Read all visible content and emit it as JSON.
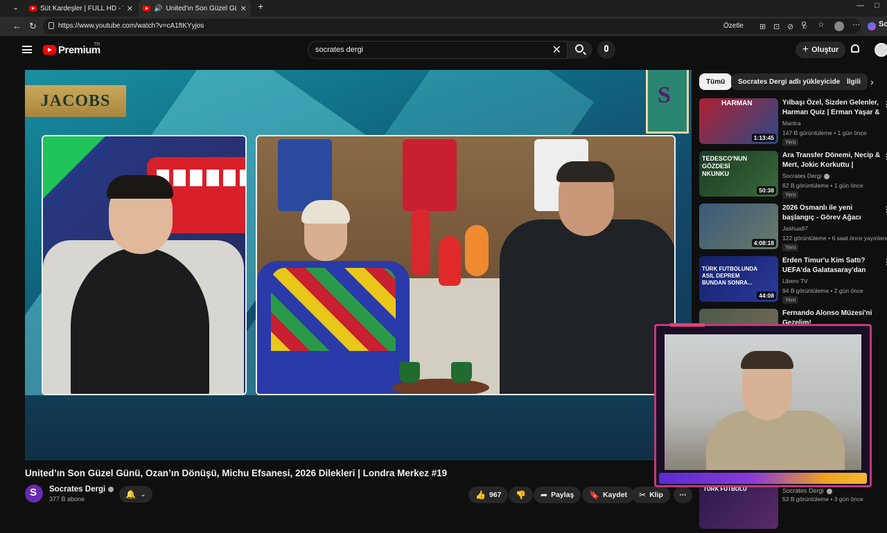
{
  "browser": {
    "tabs": [
      {
        "title": "Süt Kardeşler | FULL HD - YouTube",
        "close": "✕"
      },
      {
        "title": "United'ın Son Güzel Günü, Oza",
        "close": "✕"
      }
    ],
    "new_tab": "+",
    "url": "https://www.youtube.com/watch?v=cA1ftKYyjos",
    "summarize_label": "Özetle",
    "profile_label": "Sc",
    "window_controls": [
      "—",
      "□"
    ]
  },
  "youtube": {
    "brand": "Premium",
    "brand_region": "TR",
    "search": {
      "value": "socrates dergi",
      "clear": "✕"
    },
    "create_label": "Oluştur"
  },
  "video": {
    "sponsor": "JACOBS",
    "crest_letter": "S",
    "title": "United’ın Son Güzel Günü, Ozan’ın Dönüşü, Michu Efsanesi, 2026 Dilekleri | Londra Merkez #19",
    "channel": "Socrates Dergi",
    "channel_initial": "S",
    "subscribers": "377 B abone",
    "likes": "967",
    "actions": {
      "share": "Paylaş",
      "save": "Kaydet",
      "clip": "Klip",
      "more": "⋯"
    }
  },
  "chips": [
    {
      "label": "Tümü",
      "selected": true
    },
    {
      "label": "Socrates Dergi adlı yükleyiciden",
      "selected": false
    },
    {
      "label": "İlgili",
      "selected": false
    }
  ],
  "recommendations": [
    {
      "title": "Yılbaşı Özel, Sizden Gelenler, Harman Quiz | Erman Yaşar & ...",
      "channel": "Mantra",
      "meta": "147 B görüntüleme • 1 gün önce",
      "badge": "Yeni",
      "duration": "1:13:45",
      "thumb_text": "HARMAN",
      "thumb_color": "#b02030"
    },
    {
      "title": "Ara Transfer Dönemi, Necip & Mert, Jokic Korkuttu | Mehmet...",
      "channel": "Socrates Dergi",
      "meta": "62 B görüntüleme • 1 gün önce",
      "badge": "Yeni",
      "duration": "50:38",
      "thumb_text": "TEDESCO'NUN GÖZDESİ NKUNKU",
      "thumb_color": "#2a6a3a"
    },
    {
      "title": "2026 Osmanlı ile yeni başlangıç - Görev Ağacı tamamlamaca",
      "channel": "Jashua97",
      "meta": "122 görüntüleme • 6 saat önce yayınlandı",
      "badge": "Yeni",
      "duration": "4:08:18",
      "thumb_text": "",
      "thumb_color": "#4a6a8a"
    },
    {
      "title": "Erden Timur'u Kim Sattı? UEFA'da Galatasaray'dan Daha...",
      "channel": "Libero TV",
      "meta": "94 B görüntüleme • 2 gün önce",
      "badge": "Yeni",
      "duration": "44:08",
      "thumb_text": "TÜRK FUTBOLUNDA ASIL DEPREM BUNDAN SONRA...",
      "thumb_color": "#1a2a6a"
    },
    {
      "title": "Fernando Alonso Müzesi'ni Gezelim!",
      "channel": "",
      "meta": "",
      "badge": "",
      "duration": "",
      "thumb_text": "",
      "thumb_color": "#5a6a5a"
    }
  ],
  "bottom_rec": {
    "channel": "Socrates Dergi",
    "meta": "53 B görüntüleme • 3 gün önce",
    "thumb_text": "TÜRK FUTBOLU"
  }
}
